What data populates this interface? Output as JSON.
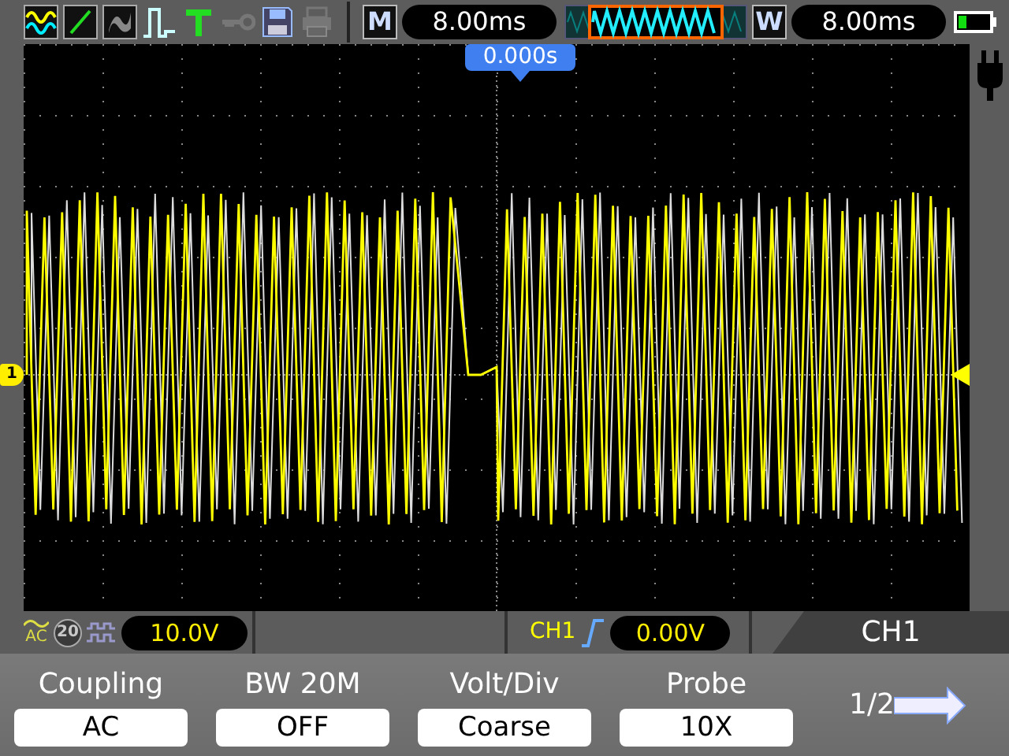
{
  "toolbar": {
    "memory_label": "M",
    "timebase": "8.00ms",
    "window_label": "W",
    "window_timebase": "8.00ms"
  },
  "trigger_position": "0.000s",
  "channel_marker": "1",
  "status": {
    "coupling_indicator": "AC",
    "bw_indicator": "20",
    "bw_limit_on": false,
    "volts_div": "10.0V",
    "trigger_source": "CH1",
    "trigger_level": "0.00V"
  },
  "menu": {
    "title": "CH1",
    "items": [
      {
        "label": "Coupling",
        "value": "AC"
      },
      {
        "label": "BW 20M",
        "value": "OFF"
      },
      {
        "label": "Volt/Div",
        "value": "Coarse"
      },
      {
        "label": "Probe",
        "value": "10X"
      }
    ],
    "page": "1/2"
  }
}
